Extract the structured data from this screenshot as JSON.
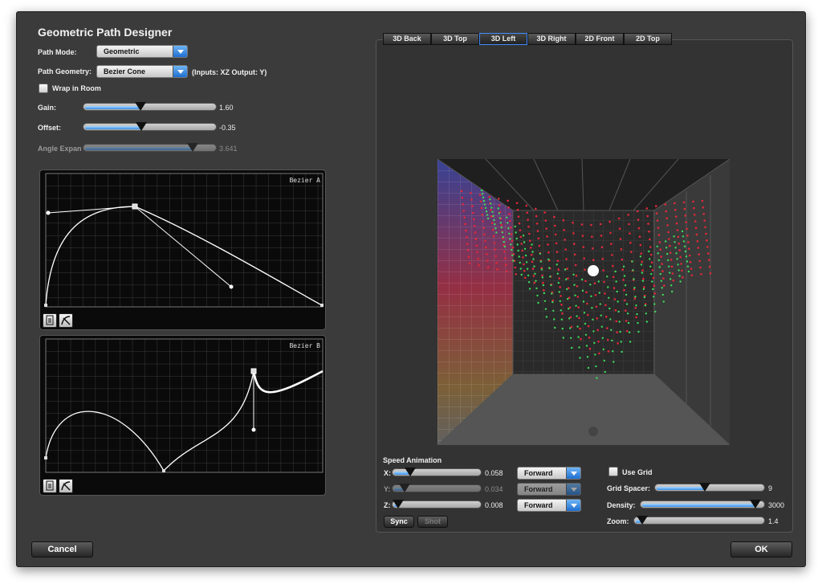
{
  "window": {
    "title": "Geometric Path Designer"
  },
  "controls": {
    "path_mode_label": "Path Mode:",
    "path_mode_value": "Geometric",
    "path_geometry_label": "Path Geometry:",
    "path_geometry_value": "Bezier Cone",
    "path_geometry_note": "(Inputs: XZ Output: Y)",
    "wrap_in_room_label": "Wrap in Room",
    "wrap_in_room_checked": false,
    "gain": {
      "label": "Gain:",
      "value": "1.60",
      "level": 0.45
    },
    "offset": {
      "label": "Offset:",
      "value": "-0.35",
      "level": 0.46
    },
    "angle_expansion": {
      "label": "Angle Expan",
      "value": "3.641",
      "level": 0.88,
      "enabled": false
    }
  },
  "bezier_panels": [
    {
      "label": "Bezier A"
    },
    {
      "label": "Bezier B"
    }
  ],
  "view_tabs": [
    {
      "label": "3D Back",
      "active": false
    },
    {
      "label": "3D Top",
      "active": false
    },
    {
      "label": "3D Left",
      "active": true
    },
    {
      "label": "3D Right",
      "active": false
    },
    {
      "label": "2D Front",
      "active": false
    },
    {
      "label": "2D Top",
      "active": false
    }
  ],
  "speed_animation": {
    "title": "Speed Animation",
    "axes": [
      {
        "label": "X:",
        "value": "0.058",
        "level": 0.2,
        "direction": "Forward",
        "enabled": true
      },
      {
        "label": "Y:",
        "value": "0.034",
        "level": 0.12,
        "direction": "Forward",
        "enabled": false
      },
      {
        "label": "Z:",
        "value": "0.008",
        "level": 0.04,
        "direction": "Forward",
        "enabled": true
      }
    ],
    "sync_label": "Sync",
    "shot_label": "Shot"
  },
  "grid": {
    "use_grid_label": "Use Grid",
    "use_grid_checked": false,
    "grid_spacer": {
      "label": "Grid Spacer:",
      "value": "9",
      "level": 0.48
    },
    "density": {
      "label": "Density:",
      "value": "3000",
      "level": 1.0
    },
    "zoom": {
      "label": "Zoom:",
      "value": "1.4",
      "level": 0.05
    }
  },
  "footer": {
    "cancel_label": "Cancel",
    "ok_label": "OK"
  },
  "colors": {
    "accent": "#3b8ee6",
    "curve_red": "#e0283a",
    "curve_green": "#3ddc5a",
    "panel_bg": "#0a0a0a"
  }
}
